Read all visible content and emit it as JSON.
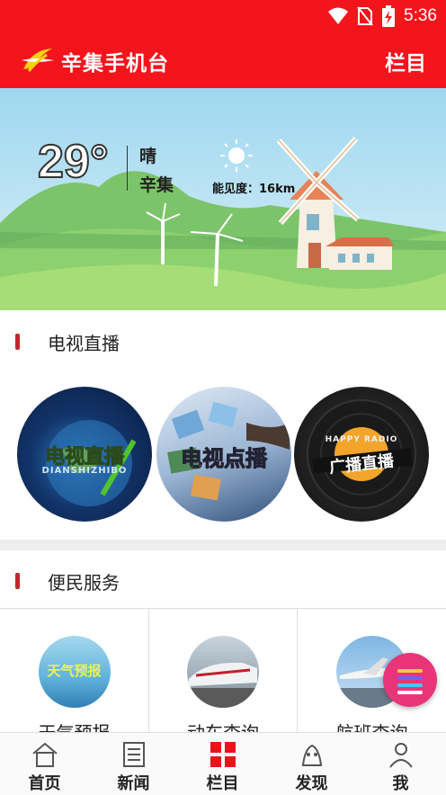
{
  "status_bar": {
    "time": "5:36"
  },
  "header": {
    "app_title": "辛集手机台",
    "menu_label": "栏目"
  },
  "weather": {
    "temperature": "29°",
    "condition": "晴",
    "city": "辛集",
    "visibility": "能见度：16km"
  },
  "tv_section": {
    "title": "电视直播",
    "items": [
      {
        "label": "电视直播",
        "sub": "DIANSHIZHIBO"
      },
      {
        "label": "电视点播"
      },
      {
        "label": "广播直播",
        "sub": "HAPPY RADIO"
      }
    ]
  },
  "service_section": {
    "title": "便民服务",
    "items": [
      {
        "label": "天气预报",
        "thumb_text": "天气预报"
      },
      {
        "label": "动车查询"
      },
      {
        "label": "航班查询"
      }
    ]
  },
  "bottom_nav": [
    {
      "label": "首页",
      "icon": "home-icon"
    },
    {
      "label": "新闻",
      "icon": "news-icon"
    },
    {
      "label": "栏目",
      "icon": "grid-icon"
    },
    {
      "label": "发现",
      "icon": "discover-icon"
    },
    {
      "label": "我",
      "icon": "user-icon"
    }
  ],
  "colors": {
    "brand_red": "#f4141c",
    "section_bar": "#c2272d",
    "fab_pink": "#e8357a"
  }
}
